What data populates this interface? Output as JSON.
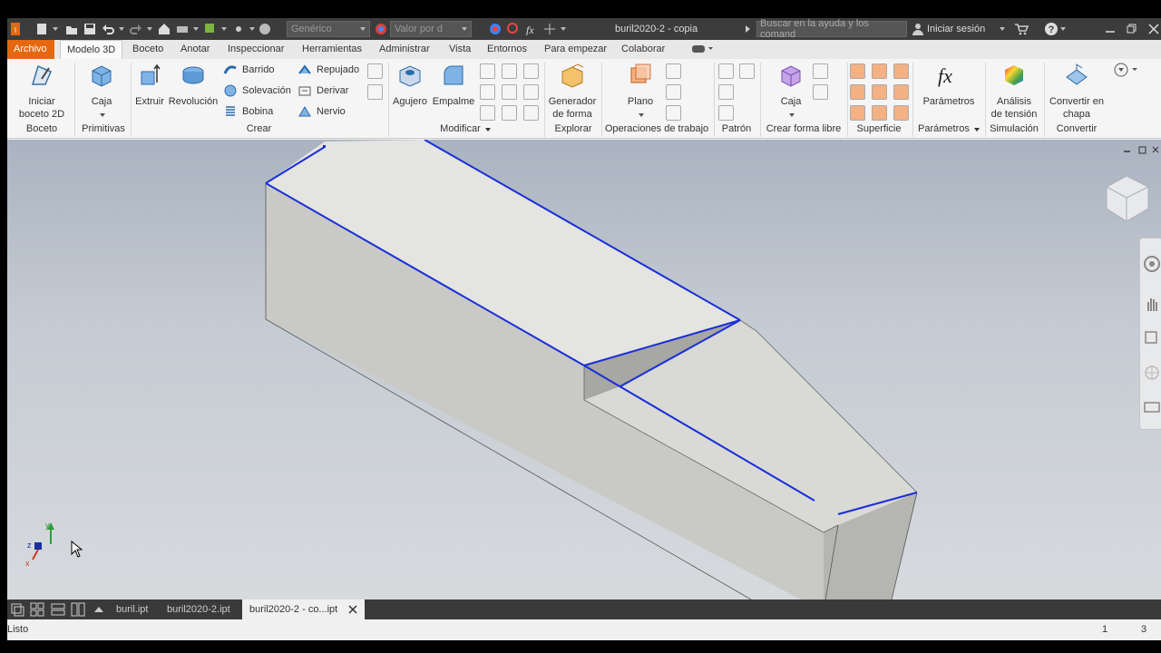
{
  "titlebar": {
    "material": "Genérico",
    "appearance": "Valor por d",
    "doc_title": "buril2020-2 - copia",
    "search_placeholder": "Buscar en la ayuda y los comand",
    "signin": "Iniciar sesión"
  },
  "tabs": [
    "Archivo",
    "Modelo 3D",
    "Boceto",
    "Anotar",
    "Inspeccionar",
    "Herramientas",
    "Administrar",
    "Vista",
    "Entornos",
    "Para empezar",
    "Colaborar"
  ],
  "active_tab": "Modelo 3D",
  "ribbon": {
    "boceto": {
      "btn": "Iniciar boceto 2D",
      "label": "Boceto"
    },
    "primitivas": {
      "btn": "Caja",
      "label": "Primitivas"
    },
    "crear": {
      "extruir": "Extruir",
      "revolucion": "Revolución",
      "barrido": "Barrido",
      "solevacion": "Solevación",
      "bobina": "Bobina",
      "repujado": "Repujado",
      "derivar": "Derivar",
      "nervio": "Nervio",
      "label": "Crear"
    },
    "modificar": {
      "agujero": "Agujero",
      "empalme": "Empalme",
      "label": "Modificar"
    },
    "explorar": {
      "btn": "Generador de forma",
      "label": "Explorar"
    },
    "operaciones": {
      "btn": "Plano",
      "label": "Operaciones de trabajo"
    },
    "patron": {
      "label": "Patrón"
    },
    "forma_libre": {
      "btn": "Caja",
      "label": "Crear forma libre"
    },
    "superficie": {
      "label": "Superficie"
    },
    "parametros": {
      "btn": "Parámetros",
      "label": "Parámetros"
    },
    "simulacion": {
      "btn": "Análisis de tensión",
      "label": "Simulación"
    },
    "convertir": {
      "btn": "Convertir en chapa",
      "label": "Convertir"
    }
  },
  "doc_tabs": [
    "buril.ipt",
    "buril2020-2.ipt",
    "buril2020-2 - co...ipt"
  ],
  "active_doc": "buril2020-2 - co...ipt",
  "status": {
    "text": "Listo",
    "n1": "1",
    "n2": "3"
  },
  "colors": {
    "accent": "#e5670f",
    "edge_highlight": "#1a2fd8",
    "part_face": "#d6d6d2"
  },
  "icons": [
    "new-icon",
    "open-icon",
    "save-icon",
    "undo-icon",
    "redo-icon",
    "home-icon",
    "help-icon",
    "cart-icon",
    "viewcube-icon",
    "orbit-icon",
    "pan-icon"
  ]
}
